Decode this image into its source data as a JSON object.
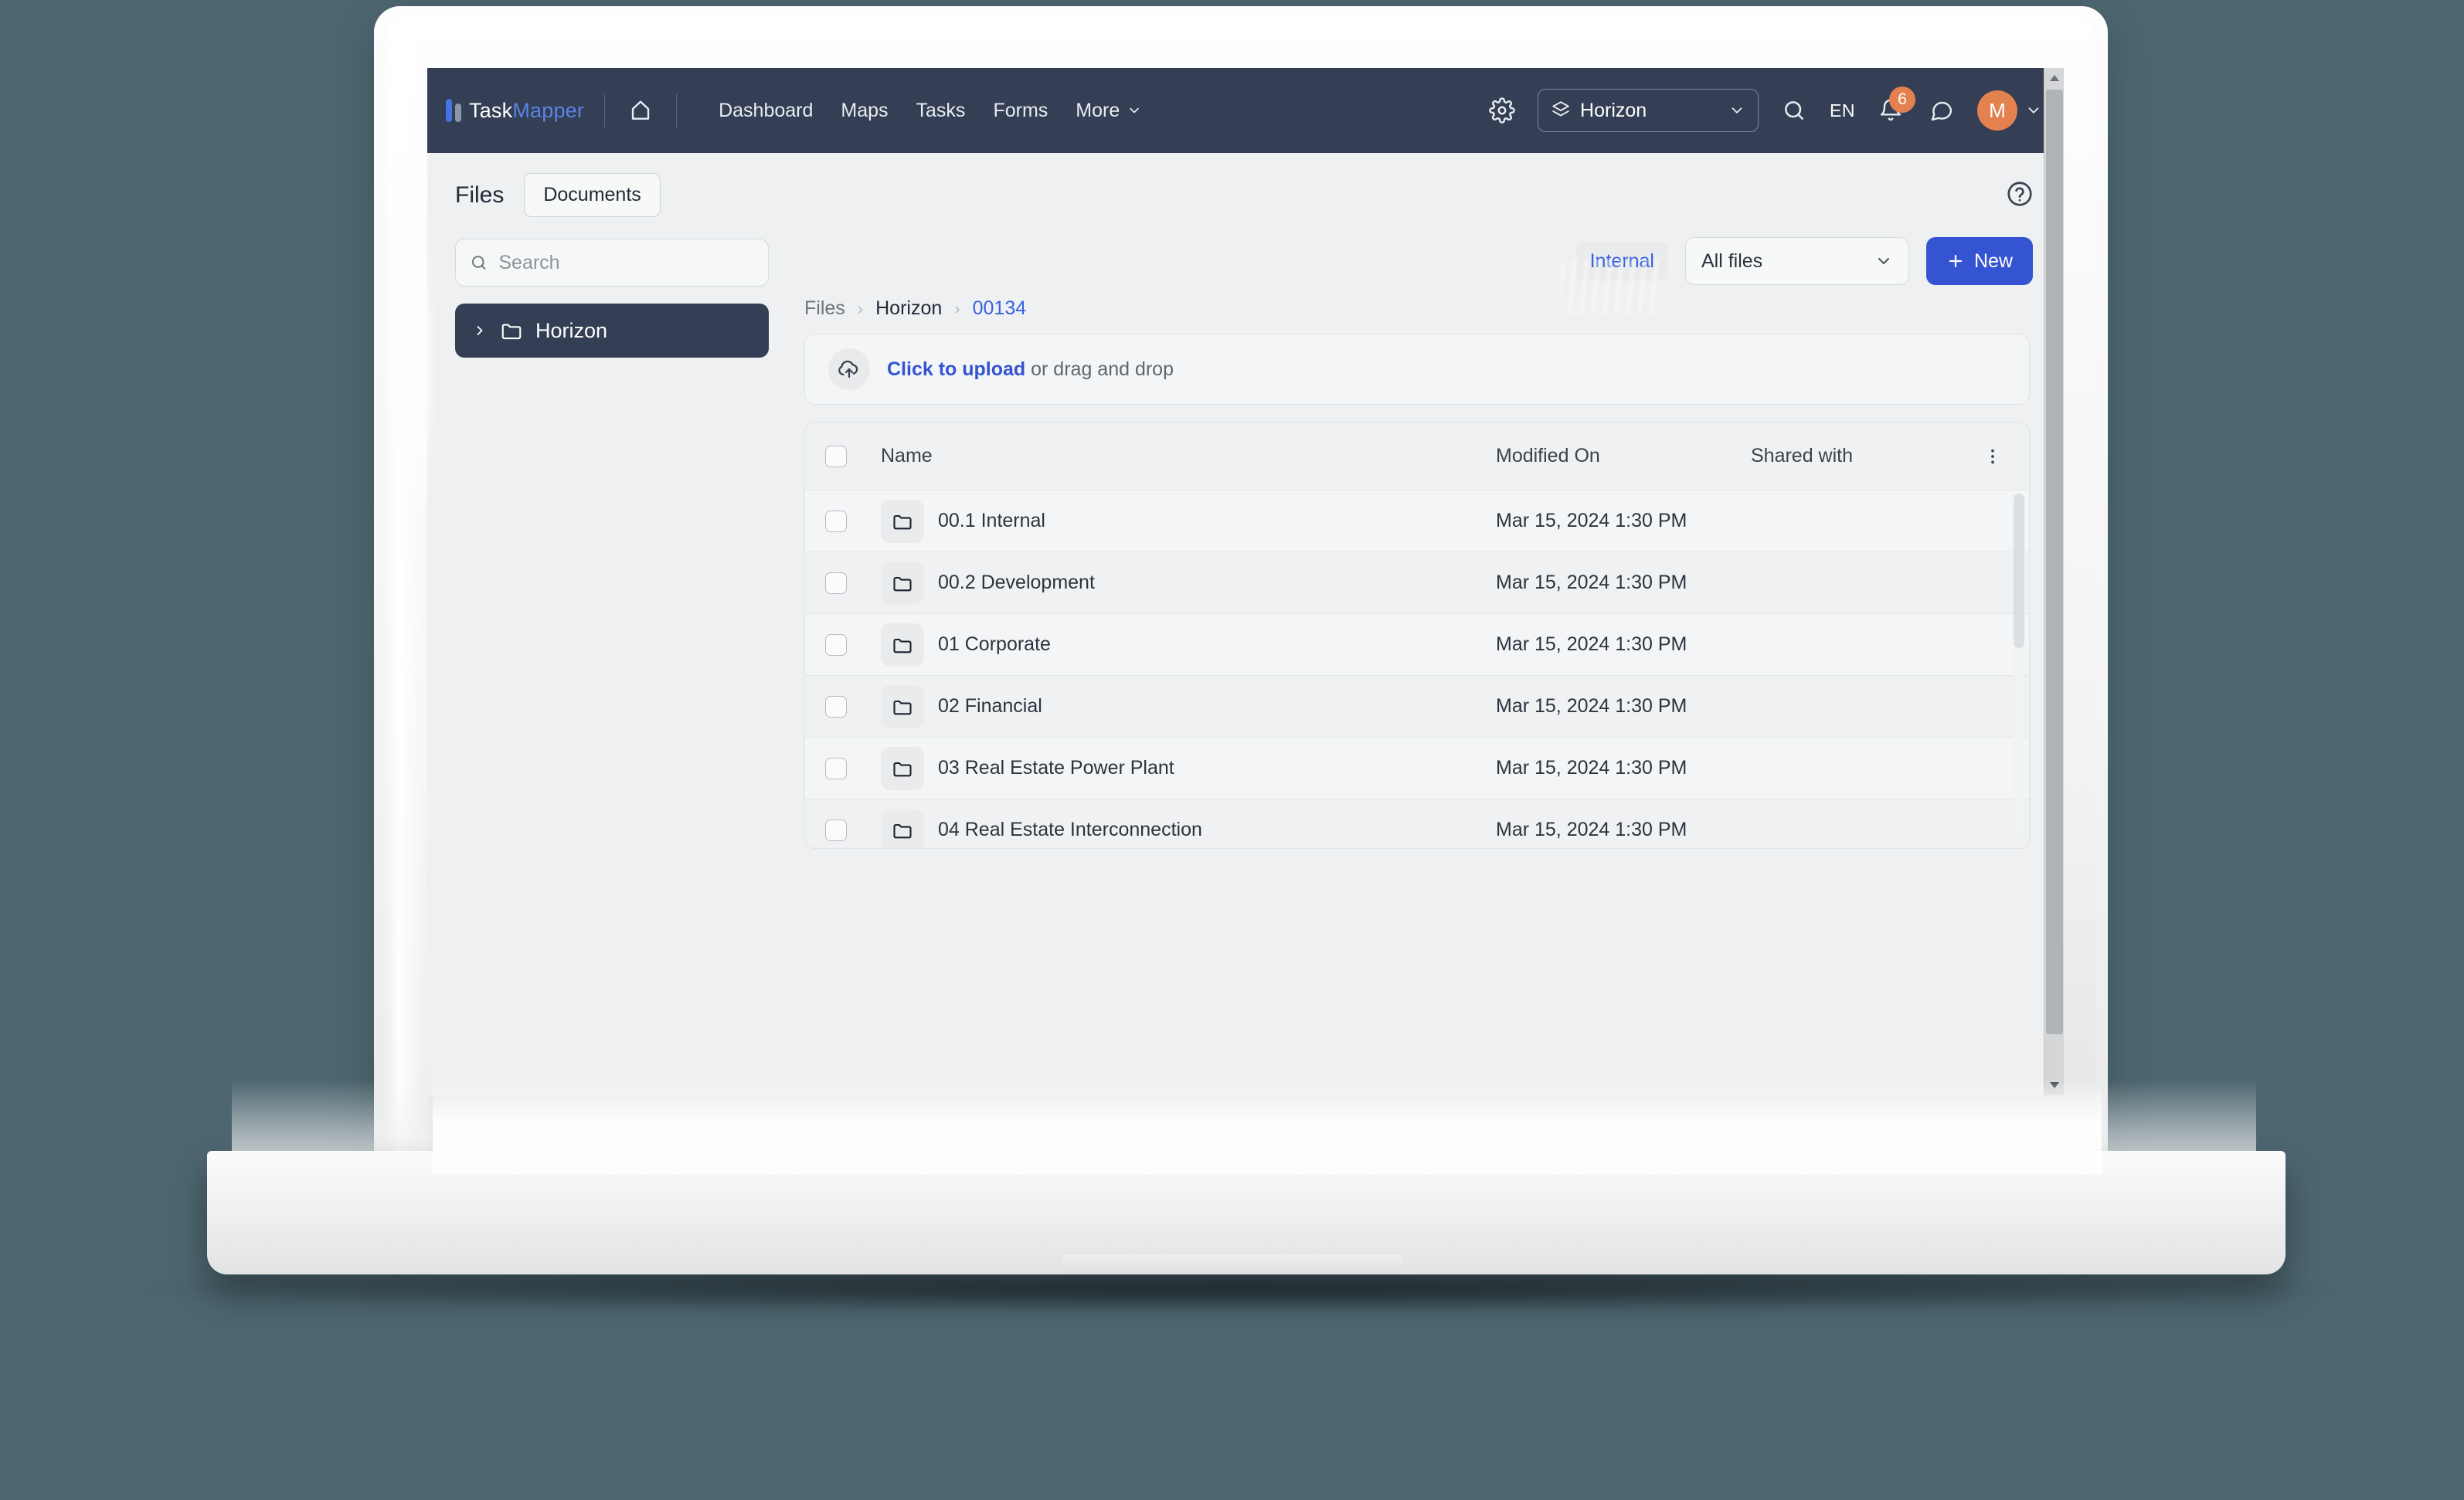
{
  "topbar": {
    "logo": {
      "brand_first": "Task",
      "brand_second": "Mapper"
    },
    "home_icon": "home-icon",
    "nav": [
      {
        "label": "Dashboard"
      },
      {
        "label": "Maps"
      },
      {
        "label": "Tasks"
      },
      {
        "label": "Forms"
      },
      {
        "label": "More"
      }
    ],
    "gear_icon": "gear-icon",
    "project_selector": {
      "value": "Horizon",
      "icon": "layers-icon",
      "caret": "chevron-down-icon"
    },
    "search_icon": "search-icon",
    "language": "EN",
    "notifications": {
      "icon": "bell-icon",
      "count": "6"
    },
    "chat_icon": "chat-bubble-icon",
    "avatar": {
      "initial": "M",
      "caret": "chevron-down-icon"
    },
    "accent_navy": "#343f55",
    "accent_orange": "#e3814f",
    "accent_blue": "#5b83e6"
  },
  "page": {
    "title": "Files",
    "tab": "Documents",
    "help_icon": "help-circle-icon"
  },
  "sidebar": {
    "search": {
      "placeholder": "Search",
      "value": "",
      "icon": "search-icon"
    },
    "tree": [
      {
        "label": "Horizon",
        "chevron": "chevron-right-icon",
        "icon": "folder-icon",
        "selected": true
      }
    ]
  },
  "toolbar": {
    "chip": "Internal",
    "filter": {
      "value": "All files",
      "caret": "chevron-down-icon"
    },
    "new_button": {
      "label": "New",
      "icon": "plus-icon"
    },
    "accent_primary": "#3554d1"
  },
  "breadcrumb": [
    {
      "label": "Files",
      "style": "muted"
    },
    {
      "label": "Horizon",
      "style": "dark"
    },
    {
      "label": "00134",
      "style": "link"
    }
  ],
  "upload": {
    "icon": "cloud-upload-icon",
    "link": "Click to upload",
    "rest": " or drag and drop"
  },
  "table": {
    "columns": [
      "Name",
      "Modified On",
      "Shared with"
    ],
    "kebab_icon": "more-vertical-icon",
    "select_all_checkbox": false,
    "rows": [
      {
        "name": "00.1 Internal",
        "modified": "Mar 15, 2024 1:30 PM",
        "shared": "",
        "icon": "folder-icon",
        "checked": false
      },
      {
        "name": "00.2 Development",
        "modified": "Mar 15, 2024 1:30 PM",
        "shared": "",
        "icon": "folder-icon",
        "checked": false
      },
      {
        "name": "01 Corporate",
        "modified": "Mar 15, 2024 1:30 PM",
        "shared": "",
        "icon": "folder-icon",
        "checked": false
      },
      {
        "name": "02 Financial",
        "modified": "Mar 15, 2024 1:30 PM",
        "shared": "",
        "icon": "folder-icon",
        "checked": false
      },
      {
        "name": "03 Real Estate Power Plant",
        "modified": "Mar 15, 2024 1:30 PM",
        "shared": "",
        "icon": "folder-icon",
        "checked": false
      },
      {
        "name": "04 Real Estate Interconnection",
        "modified": "Mar 15, 2024 1:30 PM",
        "shared": "",
        "icon": "folder-icon",
        "checked": false
      }
    ]
  },
  "scrollbar": {
    "up_arrow": "triangle-up-icon",
    "down_arrow": "triangle-down-icon"
  }
}
